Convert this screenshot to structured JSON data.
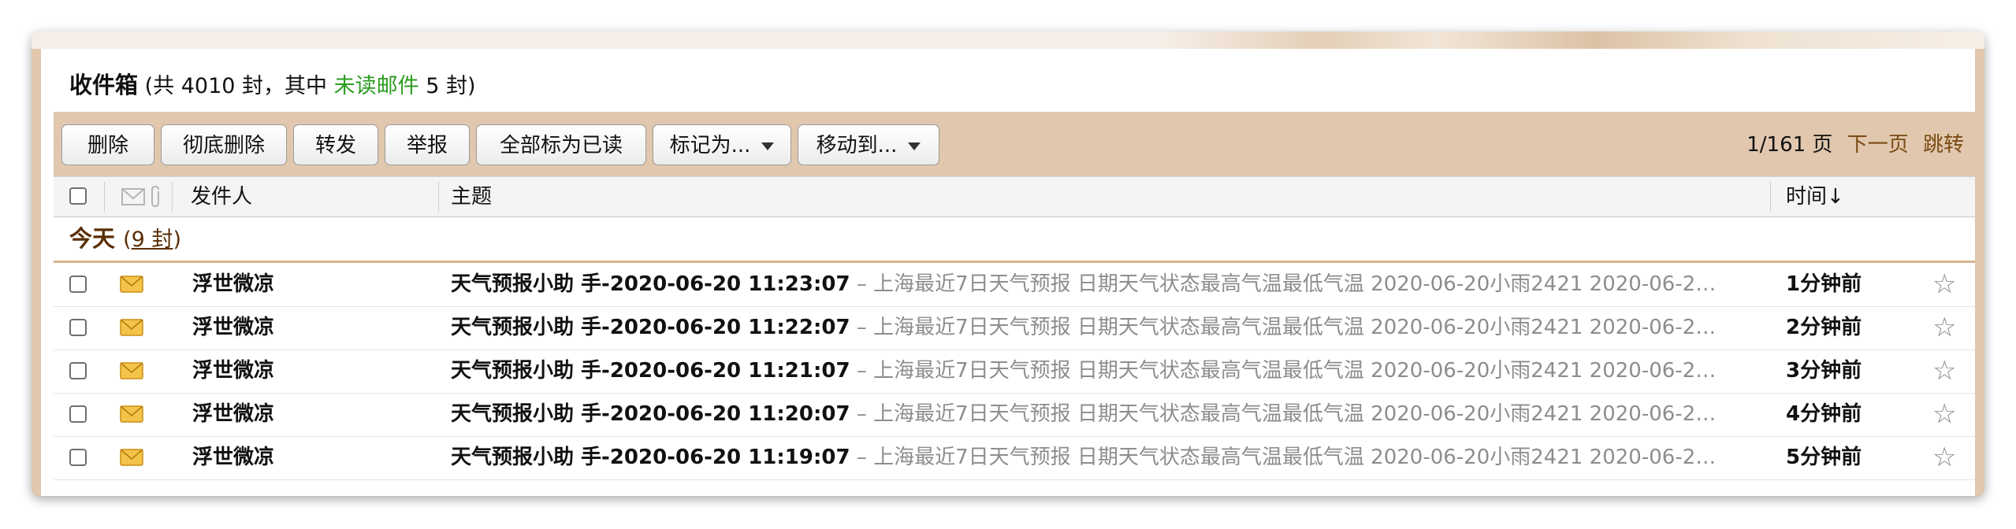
{
  "mailbox": {
    "name": "收件箱",
    "summary_prefix": "(共 4010 封，其中",
    "unread_label": "未读邮件",
    "summary_suffix": "5 封)"
  },
  "toolbar": {
    "delete": "删除",
    "delete_permanently": "彻底删除",
    "forward": "转发",
    "report": "举报",
    "mark_all_read": "全部标为已读",
    "mark_as": "标记为...",
    "move_to": "移动到..."
  },
  "pager": {
    "position": "1/161 页",
    "next": "下一页",
    "jump": "跳转"
  },
  "columns": {
    "sender": "发件人",
    "subject": "主题",
    "time": "时间↓"
  },
  "group": {
    "label": "今天",
    "count_open": "(",
    "count": "9 封",
    "count_close": ")"
  },
  "mails": [
    {
      "sender": "浮世微凉",
      "subject": "天气预报小助 手-2020-06-20 11:23:07",
      "preview": "– 上海最近7日天气预报 日期天气状态最高气温最低气温 2020-06-20小雨2421 2020-06-2…",
      "time": "1分钟前"
    },
    {
      "sender": "浮世微凉",
      "subject": "天气预报小助 手-2020-06-20 11:22:07",
      "preview": "– 上海最近7日天气预报 日期天气状态最高气温最低气温 2020-06-20小雨2421 2020-06-2…",
      "time": "2分钟前"
    },
    {
      "sender": "浮世微凉",
      "subject": "天气预报小助 手-2020-06-20 11:21:07",
      "preview": "– 上海最近7日天气预报 日期天气状态最高气温最低气温 2020-06-20小雨2421 2020-06-2…",
      "time": "3分钟前"
    },
    {
      "sender": "浮世微凉",
      "subject": "天气预报小助 手-2020-06-20 11:20:07",
      "preview": "– 上海最近7日天气预报 日期天气状态最高气温最低气温 2020-06-20小雨2421 2020-06-2…",
      "time": "4分钟前"
    },
    {
      "sender": "浮世微凉",
      "subject": "天气预报小助 手-2020-06-20 11:19:07",
      "preview": "– 上海最近7日天气预报 日期天气状态最高气温最低气温 2020-06-20小雨2421 2020-06-2…",
      "time": "5分钟前"
    }
  ],
  "icons": {
    "envelope": "envelope-icon",
    "attachment": "paperclip-icon",
    "star": "star-icon"
  },
  "colors": {
    "toolbar_bg": "#e0c7ad",
    "unread_green": "#2d9b20",
    "link_brown": "#7a4a12",
    "group_label": "#5a2e06",
    "envelope_yellow": "#f4c34a"
  }
}
